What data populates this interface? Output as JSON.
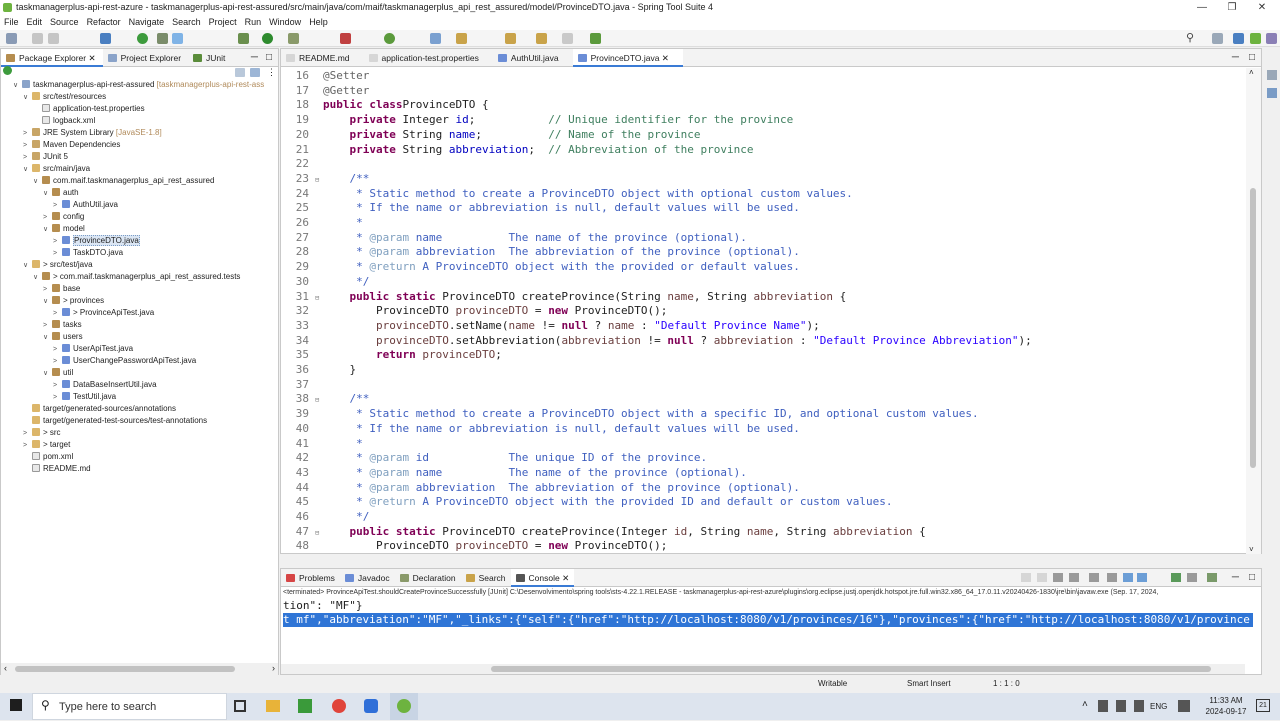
{
  "window": {
    "title": "taskmanagerplus-api-rest-azure - taskmanagerplus-api-rest-assured/src/main/java/com/maif/taskmanagerplus_api_rest_assured/model/ProvinceDTO.java - Spring Tool Suite 4"
  },
  "menu": [
    "File",
    "Edit",
    "Source",
    "Refactor",
    "Navigate",
    "Search",
    "Project",
    "Run",
    "Window",
    "Help"
  ],
  "left_tabs": [
    "Package Explorer",
    "Project Explorer",
    "JUnit"
  ],
  "tree": [
    {
      "depth": 0,
      "tw": "∨",
      "icon": "proj",
      "label": "taskmanagerplus-api-rest-assured",
      "dec": "[taskmanagerplus-api-rest-ass"
    },
    {
      "depth": 1,
      "tw": "∨",
      "icon": "folder",
      "label": "src/test/resources"
    },
    {
      "depth": 2,
      "tw": "",
      "icon": "file",
      "label": "application-test.properties"
    },
    {
      "depth": 2,
      "tw": "",
      "icon": "file",
      "label": "logback.xml"
    },
    {
      "depth": 1,
      "tw": ">",
      "icon": "lib",
      "label": "JRE System Library",
      "dec": "[JavaSE-1.8]"
    },
    {
      "depth": 1,
      "tw": ">",
      "icon": "lib",
      "label": "Maven Dependencies"
    },
    {
      "depth": 1,
      "tw": ">",
      "icon": "lib",
      "label": "JUnit 5"
    },
    {
      "depth": 1,
      "tw": "∨",
      "icon": "folder",
      "label": "src/main/java"
    },
    {
      "depth": 2,
      "tw": "∨",
      "icon": "pkg",
      "label": "com.maif.taskmanagerplus_api_rest_assured"
    },
    {
      "depth": 3,
      "tw": "∨",
      "icon": "pkg",
      "label": "auth"
    },
    {
      "depth": 4,
      "tw": ">",
      "icon": "java",
      "label": "AuthUtil.java"
    },
    {
      "depth": 3,
      "tw": ">",
      "icon": "pkg",
      "label": "config"
    },
    {
      "depth": 3,
      "tw": "∨",
      "icon": "pkg",
      "label": "model"
    },
    {
      "depth": 4,
      "tw": ">",
      "icon": "java",
      "label": "ProvinceDTO.java",
      "selected": true
    },
    {
      "depth": 4,
      "tw": ">",
      "icon": "java",
      "label": "TaskDTO.java"
    },
    {
      "depth": 1,
      "tw": "∨",
      "icon": "folder",
      "label": "> src/test/java"
    },
    {
      "depth": 2,
      "tw": "∨",
      "icon": "pkg",
      "label": "> com.maif.taskmanagerplus_api_rest_assured.tests"
    },
    {
      "depth": 3,
      "tw": ">",
      "icon": "pkg",
      "label": "base"
    },
    {
      "depth": 3,
      "tw": "∨",
      "icon": "pkg",
      "label": "> provinces"
    },
    {
      "depth": 4,
      "tw": ">",
      "icon": "java",
      "label": "> ProvinceApiTest.java"
    },
    {
      "depth": 3,
      "tw": ">",
      "icon": "pkg",
      "label": "tasks"
    },
    {
      "depth": 3,
      "tw": "∨",
      "icon": "pkg",
      "label": "users"
    },
    {
      "depth": 4,
      "tw": ">",
      "icon": "java",
      "label": "UserApiTest.java"
    },
    {
      "depth": 4,
      "tw": ">",
      "icon": "java",
      "label": "UserChangePasswordApiTest.java"
    },
    {
      "depth": 3,
      "tw": "∨",
      "icon": "pkg",
      "label": "util"
    },
    {
      "depth": 4,
      "tw": ">",
      "icon": "java",
      "label": "DataBaseInsertUtil.java"
    },
    {
      "depth": 4,
      "tw": ">",
      "icon": "java",
      "label": "TestUtil.java"
    },
    {
      "depth": 1,
      "tw": "",
      "icon": "folder",
      "label": "target/generated-sources/annotations"
    },
    {
      "depth": 1,
      "tw": "",
      "icon": "folder",
      "label": "target/generated-test-sources/test-annotations"
    },
    {
      "depth": 1,
      "tw": ">",
      "icon": "folder",
      "label": "> src"
    },
    {
      "depth": 1,
      "tw": ">",
      "icon": "folder",
      "label": "> target"
    },
    {
      "depth": 1,
      "tw": "",
      "icon": "file",
      "label": "pom.xml"
    },
    {
      "depth": 1,
      "tw": "",
      "icon": "file",
      "label": "README.md"
    }
  ],
  "editor_tabs": [
    {
      "label": "README.md",
      "active": false
    },
    {
      "label": "application-test.properties",
      "active": false
    },
    {
      "label": "AuthUtil.java",
      "active": false
    },
    {
      "label": "ProvinceDTO.java",
      "active": true
    }
  ],
  "code": [
    {
      "n": "16",
      "f": false,
      "parts": [
        [
          "an",
          "@Setter"
        ]
      ]
    },
    {
      "n": "17",
      "f": false,
      "parts": [
        [
          "an",
          "@Getter"
        ]
      ]
    },
    {
      "n": "18",
      "f": false,
      "parts": [
        [
          "kw",
          "public class"
        ],
        [
          "",
          "ProvinceDTO {"
        ]
      ]
    },
    {
      "n": "19",
      "f": false,
      "parts": [
        [
          "",
          "    "
        ],
        [
          "kw",
          "private"
        ],
        [
          "",
          " Integer "
        ],
        [
          "fd",
          "id"
        ],
        [
          "",
          ";           "
        ],
        [
          "cm",
          "// Unique identifier for the province"
        ]
      ]
    },
    {
      "n": "20",
      "f": false,
      "parts": [
        [
          "",
          "    "
        ],
        [
          "kw",
          "private"
        ],
        [
          "",
          " String "
        ],
        [
          "fd",
          "name"
        ],
        [
          "",
          ";          "
        ],
        [
          "cm",
          "// Name of the province"
        ]
      ]
    },
    {
      "n": "21",
      "f": false,
      "parts": [
        [
          "",
          "    "
        ],
        [
          "kw",
          "private"
        ],
        [
          "",
          " String "
        ],
        [
          "fd",
          "abbreviation"
        ],
        [
          "",
          ";  "
        ],
        [
          "cm",
          "// Abbreviation of the province"
        ]
      ]
    },
    {
      "n": "22",
      "f": false,
      "parts": []
    },
    {
      "n": "23",
      "f": true,
      "parts": [
        [
          "",
          "    "
        ],
        [
          "jd",
          "/**"
        ]
      ]
    },
    {
      "n": "24",
      "f": false,
      "parts": [
        [
          "jd",
          "     * Static method to create a ProvinceDTO object with optional custom values."
        ]
      ]
    },
    {
      "n": "25",
      "f": false,
      "parts": [
        [
          "jd",
          "     * If the name or abbreviation is null, default values will be used."
        ]
      ]
    },
    {
      "n": "26",
      "f": false,
      "parts": [
        [
          "jd",
          "     *"
        ]
      ]
    },
    {
      "n": "27",
      "f": false,
      "parts": [
        [
          "jd",
          "     * "
        ],
        [
          "tg",
          "@param"
        ],
        [
          "jd",
          " name          The name of the province (optional)."
        ]
      ]
    },
    {
      "n": "28",
      "f": false,
      "parts": [
        [
          "jd",
          "     * "
        ],
        [
          "tg",
          "@param"
        ],
        [
          "jd",
          " abbreviation  The abbreviation of the province (optional)."
        ]
      ]
    },
    {
      "n": "29",
      "f": false,
      "parts": [
        [
          "jd",
          "     * "
        ],
        [
          "tg",
          "@return"
        ],
        [
          "jd",
          " A ProvinceDTO object with the provided or default values."
        ]
      ]
    },
    {
      "n": "30",
      "f": false,
      "parts": [
        [
          "jd",
          "     */"
        ]
      ]
    },
    {
      "n": "31",
      "f": true,
      "parts": [
        [
          "",
          "    "
        ],
        [
          "kw",
          "public static"
        ],
        [
          "",
          " ProvinceDTO createProvince(String "
        ],
        [
          "pv",
          "name"
        ],
        [
          "",
          ", String "
        ],
        [
          "pv",
          "abbreviation"
        ],
        [
          "",
          " {"
        ]
      ]
    },
    {
      "n": "32",
      "f": false,
      "parts": [
        [
          "",
          "        ProvinceDTO "
        ],
        [
          "pv",
          "provinceDTO"
        ],
        [
          "",
          " = "
        ],
        [
          "kw",
          "new"
        ],
        [
          "",
          " ProvinceDTO();"
        ]
      ]
    },
    {
      "n": "33",
      "f": false,
      "parts": [
        [
          "",
          "        "
        ],
        [
          "pv",
          "provinceDTO"
        ],
        [
          "",
          ".setName("
        ],
        [
          "pv",
          "name"
        ],
        [
          "",
          " != "
        ],
        [
          "kw",
          "null"
        ],
        [
          "",
          " ? "
        ],
        [
          "pv",
          "name"
        ],
        [
          "",
          " : "
        ],
        [
          "st",
          "\"Default Province Name\""
        ],
        [
          "",
          ");"
        ]
      ]
    },
    {
      "n": "34",
      "f": false,
      "parts": [
        [
          "",
          "        "
        ],
        [
          "pv",
          "provinceDTO"
        ],
        [
          "",
          ".setAbbreviation("
        ],
        [
          "pv",
          "abbreviation"
        ],
        [
          "",
          " != "
        ],
        [
          "kw",
          "null"
        ],
        [
          "",
          " ? "
        ],
        [
          "pv",
          "abbreviation"
        ],
        [
          "",
          " : "
        ],
        [
          "st",
          "\"Default Province Abbreviation\""
        ],
        [
          "",
          ");"
        ]
      ]
    },
    {
      "n": "35",
      "f": false,
      "parts": [
        [
          "",
          "        "
        ],
        [
          "kw",
          "return"
        ],
        [
          "",
          " "
        ],
        [
          "pv",
          "provinceDTO"
        ],
        [
          "",
          ";"
        ]
      ]
    },
    {
      "n": "36",
      "f": false,
      "parts": [
        [
          "",
          "    }"
        ]
      ]
    },
    {
      "n": "37",
      "f": false,
      "parts": []
    },
    {
      "n": "38",
      "f": true,
      "parts": [
        [
          "",
          "    "
        ],
        [
          "jd",
          "/**"
        ]
      ]
    },
    {
      "n": "39",
      "f": false,
      "parts": [
        [
          "jd",
          "     * Static method to create a ProvinceDTO object with a specific ID, and optional custom values."
        ]
      ]
    },
    {
      "n": "40",
      "f": false,
      "parts": [
        [
          "jd",
          "     * If the name or abbreviation is null, default values will be used."
        ]
      ]
    },
    {
      "n": "41",
      "f": false,
      "parts": [
        [
          "jd",
          "     *"
        ]
      ]
    },
    {
      "n": "42",
      "f": false,
      "parts": [
        [
          "jd",
          "     * "
        ],
        [
          "tg",
          "@param"
        ],
        [
          "jd",
          " id            The unique ID of the province."
        ]
      ]
    },
    {
      "n": "43",
      "f": false,
      "parts": [
        [
          "jd",
          "     * "
        ],
        [
          "tg",
          "@param"
        ],
        [
          "jd",
          " name          The name of the province (optional)."
        ]
      ]
    },
    {
      "n": "44",
      "f": false,
      "parts": [
        [
          "jd",
          "     * "
        ],
        [
          "tg",
          "@param"
        ],
        [
          "jd",
          " abbreviation  The abbreviation of the province (optional)."
        ]
      ]
    },
    {
      "n": "45",
      "f": false,
      "parts": [
        [
          "jd",
          "     * "
        ],
        [
          "tg",
          "@return"
        ],
        [
          "jd",
          " A ProvinceDTO object with the provided ID and default or custom values."
        ]
      ]
    },
    {
      "n": "46",
      "f": false,
      "parts": [
        [
          "jd",
          "     */"
        ]
      ]
    },
    {
      "n": "47",
      "f": true,
      "parts": [
        [
          "",
          "    "
        ],
        [
          "kw",
          "public static"
        ],
        [
          "",
          " ProvinceDTO createProvince(Integer "
        ],
        [
          "pv",
          "id"
        ],
        [
          "",
          ", String "
        ],
        [
          "pv",
          "name"
        ],
        [
          "",
          ", String "
        ],
        [
          "pv",
          "abbreviation"
        ],
        [
          "",
          " {"
        ]
      ]
    },
    {
      "n": "48",
      "f": false,
      "parts": [
        [
          "",
          "        ProvinceDTO "
        ],
        [
          "pv",
          "provinceDTO"
        ],
        [
          "",
          " = "
        ],
        [
          "kw",
          "new"
        ],
        [
          "",
          " ProvinceDTO();"
        ]
      ]
    }
  ],
  "bottom_tabs": [
    {
      "label": "Problems",
      "active": false
    },
    {
      "label": "Javadoc",
      "active": false
    },
    {
      "label": "Declaration",
      "active": false
    },
    {
      "label": "Search",
      "active": false
    },
    {
      "label": "Console",
      "active": true
    }
  ],
  "console": {
    "header": "<terminated> ProvinceApiTest.shouldCreateProvinceSuccessfully [JUnit] C:\\Desenvolvimento\\spring tools\\sts-4.22.1.RELEASE - taskmanagerplus-api-rest-azure\\plugins\\org.eclipse.justj.openjdk.hotspot.jre.full.win32.x86_64_17.0.11.v20240426-1830\\jre\\bin\\javaw.exe  (Sep. 17, 2024,",
    "line1": "tion\": \"MF\"}",
    "line2": "t mf\",\"abbreviation\":\"MF\",\"_links\":{\"self\":{\"href\":\"http://localhost:8080/v1/provinces/16\"},\"provinces\":{\"href\":\"http://localhost:8080/v1/province"
  },
  "status": {
    "writable": "Writable",
    "insert": "Smart Insert",
    "position": "1 : 1 : 0"
  },
  "taskbar": {
    "search_placeholder": "Type here to search",
    "lang": "ENG",
    "time": "11:33 AM",
    "date": "2024-09-17",
    "notif": "21"
  },
  "colors": {
    "accent": "#3a7bd5",
    "selection": "#2f75d6",
    "spring_green": "#6db33f"
  }
}
